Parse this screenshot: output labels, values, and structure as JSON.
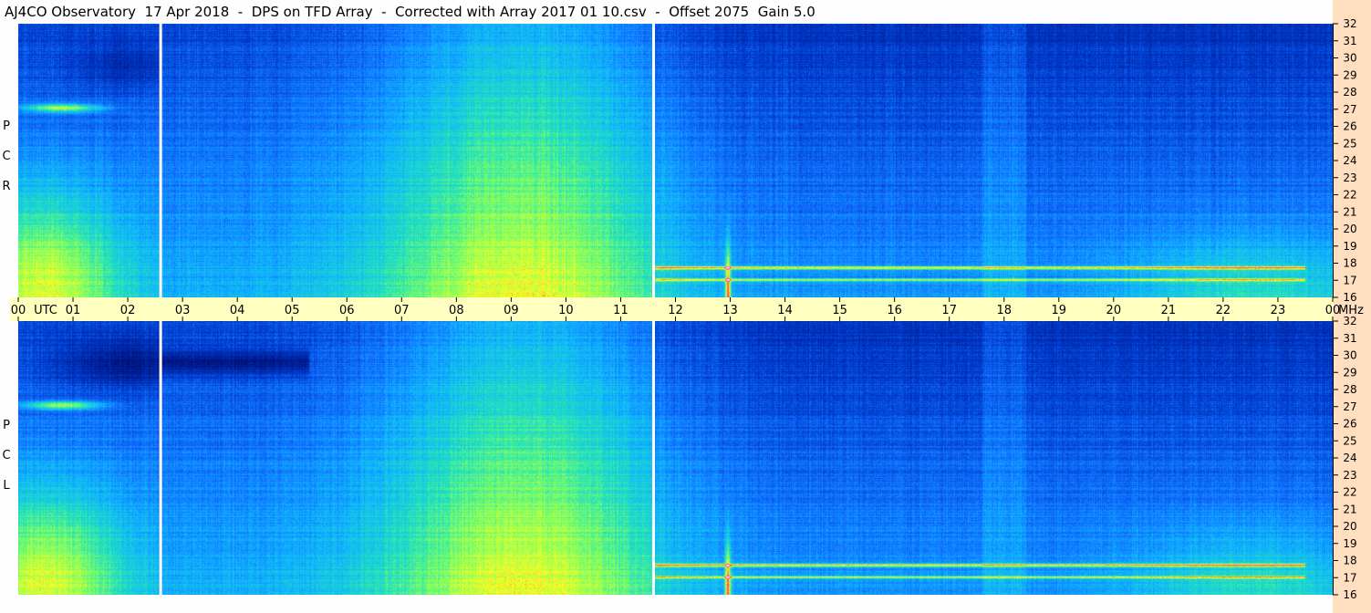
{
  "header": {
    "title": "AJ4CO Observatory  17 Apr 2018  -  DPS on TFD Array  -  Corrected with Array 2017 01 10.csv  -  Offset 2075  Gain 5.0"
  },
  "chart_data": {
    "type": "heatmap",
    "panels": [
      {
        "name": "RCP",
        "label_chars": [
          "R",
          "C",
          "P"
        ]
      },
      {
        "name": "LCP",
        "label_chars": [
          "L",
          "C",
          "P"
        ]
      }
    ],
    "x_axis": {
      "unit_label": "UTC",
      "ticks": [
        "00",
        "01",
        "02",
        "03",
        "04",
        "05",
        "06",
        "07",
        "08",
        "09",
        "10",
        "11",
        "12",
        "13",
        "14",
        "15",
        "16",
        "17",
        "18",
        "19",
        "20",
        "21",
        "22",
        "23",
        "00"
      ],
      "range_hours": [
        0,
        24
      ]
    },
    "y_axis": {
      "unit_label": "MHz",
      "range": [
        16,
        32
      ],
      "ticks": [
        "32",
        "31",
        "30",
        "29",
        "28",
        "27",
        "26",
        "25",
        "24",
        "23",
        "22",
        "21",
        "20",
        "19",
        "18",
        "17",
        "16"
      ]
    },
    "markers_utc_hours": [
      2.6,
      11.6
    ],
    "colormap": [
      "#00004a",
      "#001a8c",
      "#0038c8",
      "#1070ff",
      "#10b4ff",
      "#20e0c0",
      "#80ff60",
      "#ffff20",
      "#ff6040",
      "#ff40ff",
      "#ffffff"
    ]
  }
}
